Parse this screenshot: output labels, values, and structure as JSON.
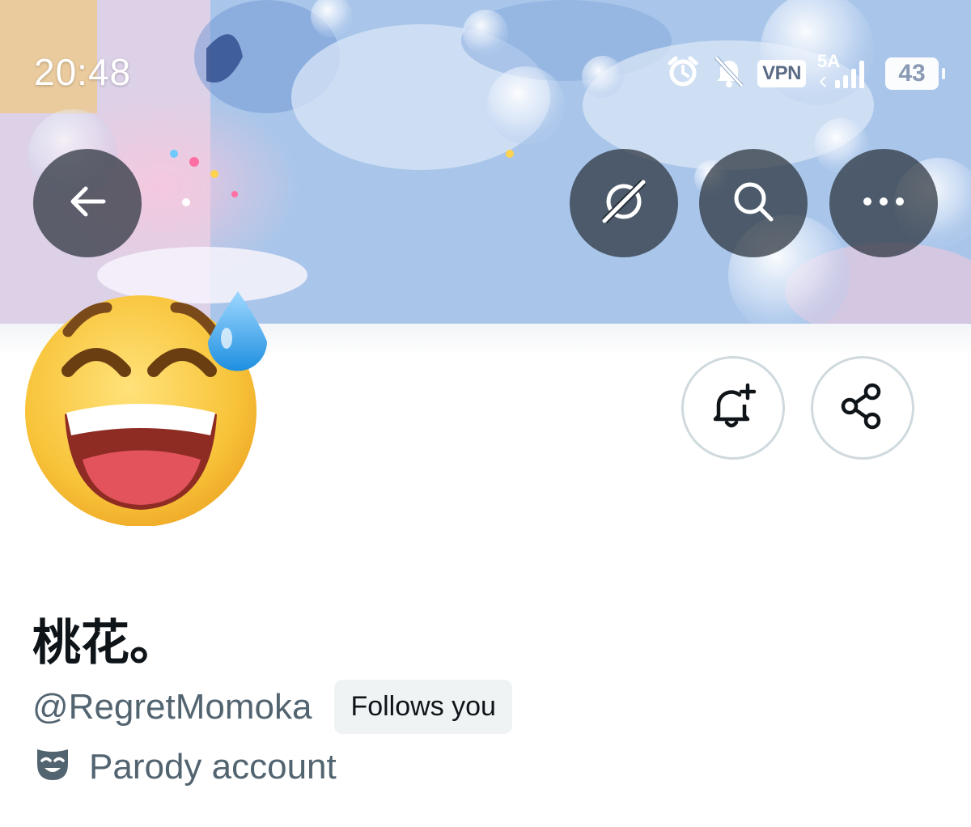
{
  "status_bar": {
    "time": "20:48",
    "vpn_label": "VPN",
    "network_label": "5A",
    "battery_level": "43",
    "icons": [
      "alarm-icon",
      "bell-muted-icon",
      "vpn-icon",
      "signal-icon",
      "battery-icon"
    ]
  },
  "header": {
    "back_icon": "arrow-left-icon",
    "grok_icon": "grok-icon",
    "search_icon": "search-icon",
    "more_icon": "more-horizontal-icon"
  },
  "profile": {
    "avatar_icon": "grinning-sweat-emoji",
    "display_name": "桃花。",
    "handle": "@RegretMomoka",
    "follows_you_label": "Follows you",
    "parody_label": "Parody account",
    "parody_icon": "mask-icon"
  },
  "actions": {
    "notify_icon": "bell-plus-icon",
    "share_icon": "share-icon"
  },
  "colors": {
    "text_primary": "#0f1419",
    "text_secondary": "#536471",
    "badge_bg": "#eff3f4",
    "outline_border": "#cfd9de",
    "overlay_button": "#28303a"
  }
}
